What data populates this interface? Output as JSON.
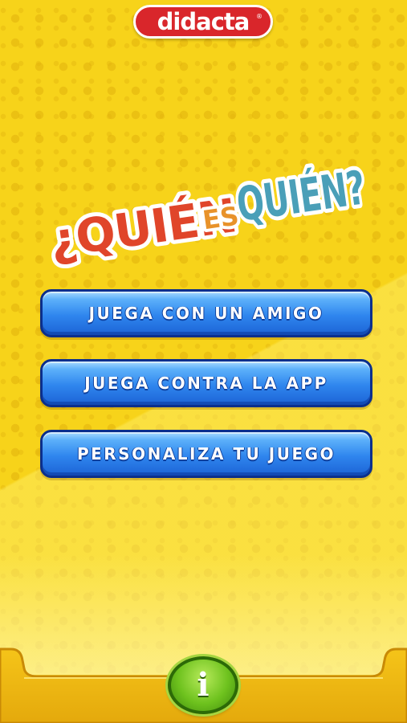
{
  "brand": {
    "name": "didacta",
    "registered": "®"
  },
  "title": {
    "line1": "¿QUIÉN",
    "connector": "ES",
    "line2": "QUIÉN?",
    "colors": {
      "quien1": "#e0452a",
      "es": "#e8922a",
      "quien2": "#4a9fb8",
      "outline": "#ffffff"
    }
  },
  "menu": {
    "items": [
      {
        "label": "JUEGA CON UN AMIGO"
      },
      {
        "label": "JUEGA CONTRA LA APP"
      },
      {
        "label": "PERSONALIZA TU JUEGO"
      }
    ]
  },
  "footer": {
    "info_icon": "info-icon",
    "info_glyph": "i"
  },
  "colors": {
    "background": "#f7d31a",
    "button_blue": "#2f86ee",
    "button_border": "#0b2f8c",
    "info_green": "#6ec21e",
    "logo_red": "#d9262b"
  }
}
